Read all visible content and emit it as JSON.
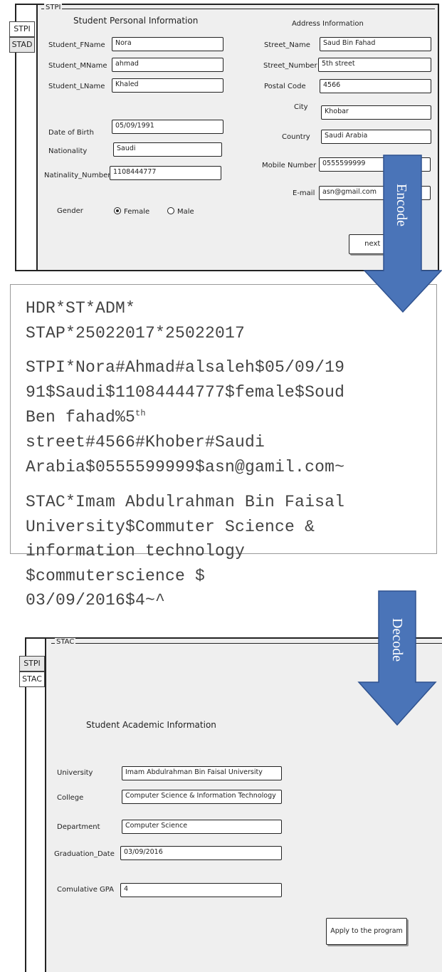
{
  "top_form": {
    "tabs": [
      "STPI",
      "STAD"
    ],
    "group_legend": "STPI",
    "personal_header": "Student Personal Information",
    "address_header": "Address Information",
    "personal_fields": [
      {
        "label": "Student_FName",
        "value": "Nora"
      },
      {
        "label": "Student_MName",
        "value": "ahmad"
      },
      {
        "label": "Student_LName",
        "value": "Khaled"
      },
      {
        "label": "Date of Birth",
        "value": "05/09/1991"
      },
      {
        "label": "Nationality",
        "value": "Saudi"
      },
      {
        "label": "Natinality_Number",
        "value": "1108444777"
      }
    ],
    "gender_label": "Gender",
    "gender_options": [
      "Female",
      "Male"
    ],
    "gender_selected": "Female",
    "address_fields": [
      {
        "label": "Street_Name",
        "value": "Saud Bin Fahad"
      },
      {
        "label": "Street_Number",
        "value": "5th street"
      },
      {
        "label": "Postal Code",
        "value": "4566"
      },
      {
        "label": "City",
        "value": "Khobar"
      },
      {
        "label": "Country",
        "value": "Saudi Arabia"
      },
      {
        "label": "Mobile Number",
        "value": "0555599999"
      },
      {
        "label": "E-mail",
        "value": "asn@gmail.com"
      }
    ],
    "next_button": "next >"
  },
  "encode_label": "Encode",
  "decode_label": "Decode",
  "message": {
    "header": [
      "HDR*ST*ADM*",
      "STAP*25022017*25022017"
    ],
    "stpi": [
      "STPI*Nora#Ahmad#alsaleh$05/09/19",
      "91$Saudi$11084444777$female$Soud",
      "Ben fahad%5",
      "street#4566#Khober#Saudi",
      "Arabia$0555599999$asn@gamil.com~"
    ],
    "stpi_sup": "th",
    "stac": [
      "STAC*Imam Abdulrahman Bin Faisal",
      "University$Commuter Science &",
      "information technology",
      "$commuterscience $",
      "03/09/2016$4~^"
    ]
  },
  "bottom_form": {
    "tabs": [
      "STPI",
      "STAC"
    ],
    "group_legend": "STAC",
    "header": "Student Academic Information",
    "fields": [
      {
        "label": "University",
        "value": "Imam Abdulrahman Bin Faisal University"
      },
      {
        "label": "College",
        "value": "Computer Science & Information Technology"
      },
      {
        "label": "Department",
        "value": "Computer Science"
      },
      {
        "label": "Graduation_Date",
        "value": "03/09/2016"
      },
      {
        "label": "Comulative GPA",
        "value": "4"
      }
    ],
    "apply_button": "Apply to the program"
  },
  "colors": {
    "arrow_fill": "#4a74b8",
    "arrow_stroke": "#2f528f",
    "panel_bg": "#efefef"
  }
}
